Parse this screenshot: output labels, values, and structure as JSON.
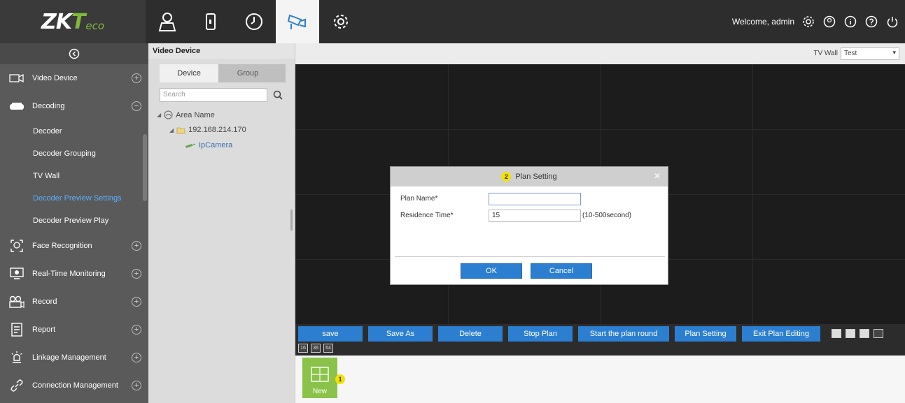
{
  "logo": {
    "zk": "ZK",
    "t": "T",
    "eco": "eco"
  },
  "header": {
    "welcome": "Welcome, admin",
    "nav_icons": [
      "user-icon",
      "door-icon",
      "clock-icon",
      "camera-icon",
      "gear-icon"
    ],
    "active_nav": "camera-icon"
  },
  "sidebar": {
    "items": [
      {
        "label": "Video Device",
        "icon": "video-device-icon",
        "toggle": "+"
      },
      {
        "label": "Decoding",
        "icon": "decoding-icon",
        "toggle": "−"
      },
      {
        "label": "Face Recognition",
        "icon": "face-icon",
        "toggle": "+"
      },
      {
        "label": "Real-Time Monitoring",
        "icon": "monitor-icon",
        "toggle": "+"
      },
      {
        "label": "Record",
        "icon": "record-icon",
        "toggle": "+"
      },
      {
        "label": "Report",
        "icon": "report-icon",
        "toggle": "+"
      },
      {
        "label": "Linkage Management",
        "icon": "linkage-icon",
        "toggle": "+"
      },
      {
        "label": "Connection Management",
        "icon": "connection-icon",
        "toggle": "+"
      }
    ],
    "sub_items": [
      {
        "label": "Decoder"
      },
      {
        "label": "Decoder Grouping"
      },
      {
        "label": "TV Wall"
      },
      {
        "label": "Decoder Preview Settings"
      },
      {
        "label": "Decoder Preview Play"
      }
    ],
    "active_sub": "Decoder Preview Settings"
  },
  "device_panel": {
    "title": "Video Device",
    "tabs": [
      "Device",
      "Group"
    ],
    "search_placeholder": "Search",
    "tree": {
      "area": "Area Name",
      "ip": "192.168.214.170",
      "camera": "IpCamera"
    }
  },
  "main": {
    "tv_wall_label": "TV Wall",
    "tv_wall_value": "Test",
    "toolbar": {
      "save": "save",
      "save_as": "Save As",
      "delete": "Delete",
      "stop_plan": "Stop Plan",
      "start_round": "Start the plan round",
      "plan_setting": "Plan Setting",
      "exit_editing": "Exit Plan Editing"
    },
    "layout_small": [
      "16",
      "36",
      "64"
    ],
    "new_plan_label": "New",
    "badge_new": "1"
  },
  "dialog": {
    "title": "Plan Setting",
    "badge": "2",
    "plan_name_label": "Plan Name*",
    "plan_name_value": "",
    "residence_label": "Residence Time*",
    "residence_value": "15",
    "residence_hint": "(10-500second)",
    "ok": "OK",
    "cancel": "Cancel"
  },
  "colors": {
    "accent": "#2c7fd0",
    "brand_green": "#7fb83a",
    "new_tile": "#8bc34a",
    "active_sub": "#5ab0ff"
  }
}
